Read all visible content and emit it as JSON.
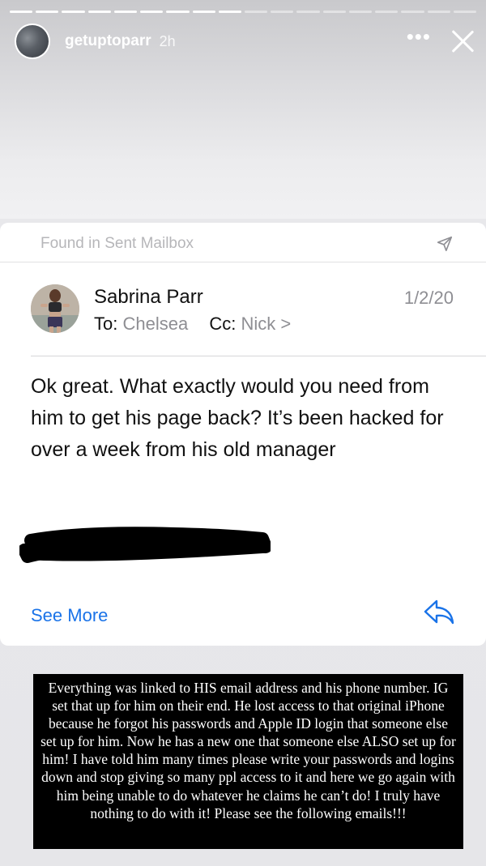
{
  "story": {
    "progress": {
      "total": 18,
      "viewed": 9
    },
    "user": {
      "username": "getuptoparr",
      "time_ago": "2h"
    },
    "menu_icon": "more-horizontal-icon",
    "close_icon": "close-icon"
  },
  "email": {
    "found_in": "Found in Sent Mailbox",
    "sender": "Sabrina Parr",
    "date": "1/2/20",
    "to_label": "To:",
    "to": "Chelsea",
    "cc_label": "Cc:",
    "cc": "Nick",
    "cc_chevron": ">",
    "body": "Ok great. What exactly would you need from him to get his page back? It’s been hacked for over a week from his old manager",
    "see_more": "See More"
  },
  "caption": "Everything was linked to HIS email address and his phone number. IG set that up for him on their end. He lost access to that original iPhone because he forgot his passwords and Apple ID login that someone else set up for him. Now he has a new one that someone else ALSO set up for him! I have told him many times please write your passwords and logins down and stop giving so many ppl access to it and here we go again with him being unable to do whatever he claims he can’t do! I truly have nothing to do with it! Please see the following emails!!!",
  "colors": {
    "link": "#1a73e8",
    "muted": "#8e8e93",
    "caption_bg": "#000000"
  }
}
